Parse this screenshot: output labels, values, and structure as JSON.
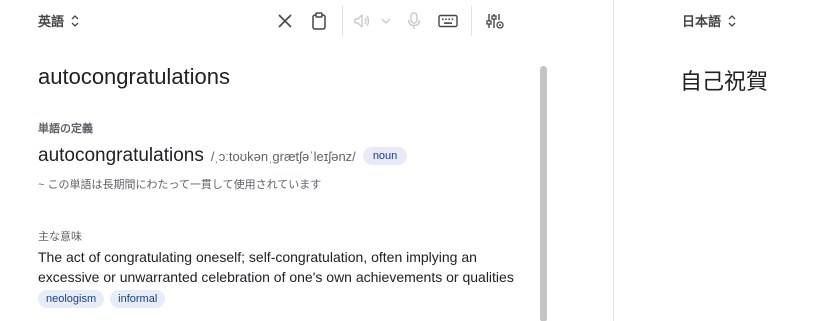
{
  "source": {
    "language": "英語",
    "text": "autocongratulations"
  },
  "toolbar": {
    "icons": [
      "close-icon",
      "clipboard-icon",
      "speaker-icon",
      "chevron-down-icon",
      "microphone-icon",
      "keyboard-icon",
      "settings-icon"
    ]
  },
  "definition": {
    "section_title": "単語の定義",
    "headword": "autocongratulations",
    "pronunciation": "/ˌɔːtoʊkənˌɡrætʃəˈleɪʃənz/",
    "part_of_speech": "noun",
    "usage_note": "~ この単語は長期間にわたって一貫して使用されています"
  },
  "meaning": {
    "section_title": "主な意味",
    "text": "The act of congratulating oneself; self-congratulation, often implying an excessive or unwarranted celebration of one's own achievements or qualities",
    "tags": [
      "neologism",
      "informal"
    ]
  },
  "target": {
    "language": "日本語",
    "text": "自己祝賀"
  },
  "colors": {
    "chip_text": "#1a3e8f",
    "chip_bg": "#e6edf9",
    "divider": "#e3e3e3"
  }
}
